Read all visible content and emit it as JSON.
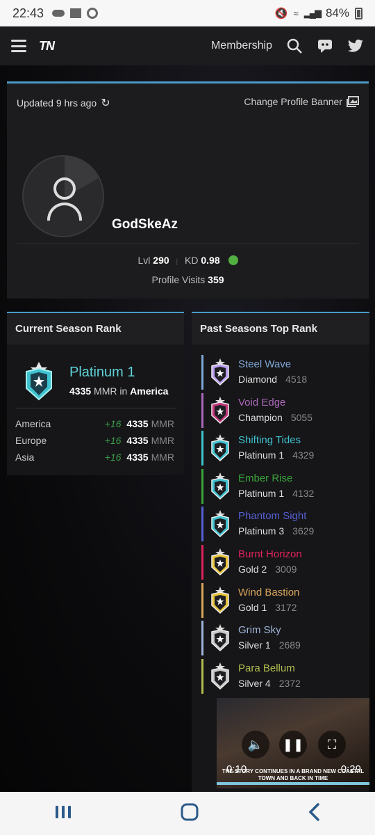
{
  "status_bar": {
    "time": "22:43",
    "battery": "84%"
  },
  "nav": {
    "logo": "TN",
    "membership": "Membership"
  },
  "profile": {
    "updated": "Updated 9 hrs ago",
    "change_banner": "Change Profile Banner",
    "username": "GodSkeAz",
    "level_label": "Lvl",
    "level": "290",
    "kd_label": "KD",
    "kd": "0.98",
    "visits_label": "Profile Visits",
    "visits": "359"
  },
  "current_season": {
    "header": "Current Season Rank",
    "rank": "Platinum 1",
    "mmr": "4335",
    "mmr_suffix": "MMR in",
    "region": "America",
    "regions": [
      {
        "name": "America",
        "delta": "+16",
        "mmr": "4335",
        "unit": "MMR"
      },
      {
        "name": "Europe",
        "delta": "+16",
        "mmr": "4335",
        "unit": "MMR"
      },
      {
        "name": "Asia",
        "delta": "+16",
        "mmr": "4335",
        "unit": "MMR"
      }
    ]
  },
  "past_seasons": {
    "header": "Past Seasons Top Rank",
    "items": [
      {
        "season": "Steel Wave",
        "rank": "Diamond",
        "mmr": "4518",
        "color": "#7fa7d6",
        "badge": "diamond"
      },
      {
        "season": "Void Edge",
        "rank": "Champion",
        "mmr": "5055",
        "color": "#a968b9",
        "badge": "champion"
      },
      {
        "season": "Shifting Tides",
        "rank": "Platinum 1",
        "mmr": "4329",
        "color": "#3ec2cf",
        "badge": "platinum"
      },
      {
        "season": "Ember Rise",
        "rank": "Platinum 1",
        "mmr": "4132",
        "color": "#3aa53a",
        "badge": "platinum"
      },
      {
        "season": "Phantom Sight",
        "rank": "Platinum 3",
        "mmr": "3629",
        "color": "#5560d6",
        "badge": "platinum"
      },
      {
        "season": "Burnt Horizon",
        "rank": "Gold 2",
        "mmr": "3009",
        "color": "#e0225c",
        "badge": "gold"
      },
      {
        "season": "Wind Bastion",
        "rank": "Gold 1",
        "mmr": "3172",
        "color": "#d8a45a",
        "badge": "gold"
      },
      {
        "season": "Grim Sky",
        "rank": "Silver 1",
        "mmr": "2689",
        "color": "#9fb4d8",
        "badge": "silver"
      },
      {
        "season": "Para Bellum",
        "rank": "Silver 4",
        "mmr": "2372",
        "color": "#b3bd4e",
        "badge": "silver"
      }
    ]
  },
  "video": {
    "time_current": "0:10",
    "time_total": "0:29",
    "caption": "THE STORY CONTINUES IN A BRAND NEW COASTAL TOWN AND BACK IN TIME"
  }
}
